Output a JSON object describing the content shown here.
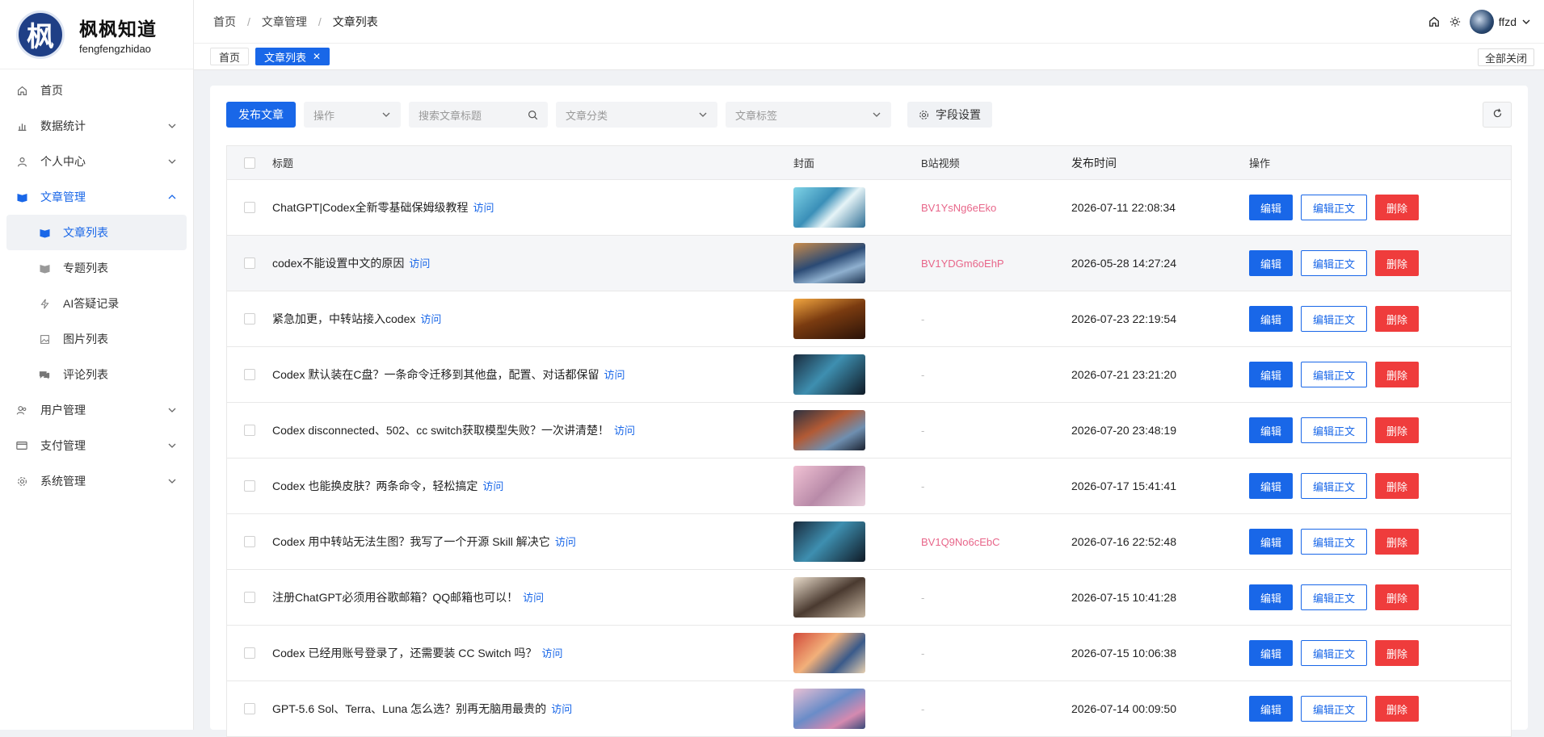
{
  "logo": {
    "glyph": "枫",
    "title": "枫枫知道",
    "subtitle": "fengfengzhidao"
  },
  "sidebar": {
    "items": [
      {
        "label": "首页",
        "icon": "home-icon"
      },
      {
        "label": "数据统计",
        "icon": "bar-chart-icon"
      },
      {
        "label": "个人中心",
        "icon": "user-icon"
      },
      {
        "label": "文章管理",
        "icon": "book-icon"
      },
      {
        "label": "文章列表",
        "icon": "book-icon"
      },
      {
        "label": "专题列表",
        "icon": "book-icon"
      },
      {
        "label": "AI答疑记录",
        "icon": "bolt-icon"
      },
      {
        "label": "图片列表",
        "icon": "image-icon"
      },
      {
        "label": "评论列表",
        "icon": "comment-icon"
      },
      {
        "label": "用户管理",
        "icon": "users-icon"
      },
      {
        "label": "支付管理",
        "icon": "card-icon"
      },
      {
        "label": "系统管理",
        "icon": "gear-icon"
      }
    ]
  },
  "breadcrumb": [
    "首页",
    "文章管理",
    "文章列表"
  ],
  "header": {
    "username": "ffzd"
  },
  "tabs": {
    "home": "首页",
    "current": "文章列表",
    "close_all": "全部关闭"
  },
  "toolbar": {
    "publish": "发布文章",
    "action_placeholder": "操作",
    "search_placeholder": "搜索文章标题",
    "category_placeholder": "文章分类",
    "tag_placeholder": "文章标签",
    "field_settings": "字段设置"
  },
  "table": {
    "headers": {
      "title": "标题",
      "cover": "封面",
      "bili": "B站视频",
      "time": "发布时间",
      "ops": "操作"
    },
    "visit_label": "访问",
    "op_labels": {
      "edit": "编辑",
      "edit_body": "编辑正文",
      "delete": "删除"
    },
    "rows": [
      {
        "title": "ChatGPT|Codex全新零基础保姆级教程",
        "bili": "BV1YsNg6eEko",
        "time": "2026-07-11 22:08:34"
      },
      {
        "title": "codex不能设置中文的原因",
        "bili": "BV1YDGm6oEhP",
        "time": "2026-05-28 14:27:24"
      },
      {
        "title": "紧急加更，中转站接入codex",
        "bili": "-",
        "time": "2026-07-23 22:19:54"
      },
      {
        "title": "Codex 默认装在C盘？一条命令迁移到其他盘，配置、对话都保留",
        "bili": "-",
        "time": "2026-07-21 23:21:20"
      },
      {
        "title": "Codex disconnected、502、cc switch获取模型失败？一次讲清楚！",
        "bili": "-",
        "time": "2026-07-20 23:48:19"
      },
      {
        "title": "Codex 也能换皮肤？两条命令，轻松搞定",
        "bili": "-",
        "time": "2026-07-17 15:41:41"
      },
      {
        "title": "Codex 用中转站无法生图？我写了一个开源 Skill 解决它",
        "bili": "BV1Q9No6cEbC",
        "time": "2026-07-16 22:52:48"
      },
      {
        "title": "注册ChatGPT必须用谷歌邮箱？QQ邮箱也可以！",
        "bili": "-",
        "time": "2026-07-15 10:41:28"
      },
      {
        "title": "Codex 已经用账号登录了，还需要装 CC Switch 吗？",
        "bili": "-",
        "time": "2026-07-15 10:06:38"
      },
      {
        "title": "GPT-5.6 Sol、Terra、Luna 怎么选？别再无脑用最贵的",
        "bili": "-",
        "time": "2026-07-14 00:09:50"
      }
    ]
  },
  "colors": {
    "accent": "#1967e8",
    "danger": "#ef3c3c",
    "bili": "#e8668a"
  }
}
